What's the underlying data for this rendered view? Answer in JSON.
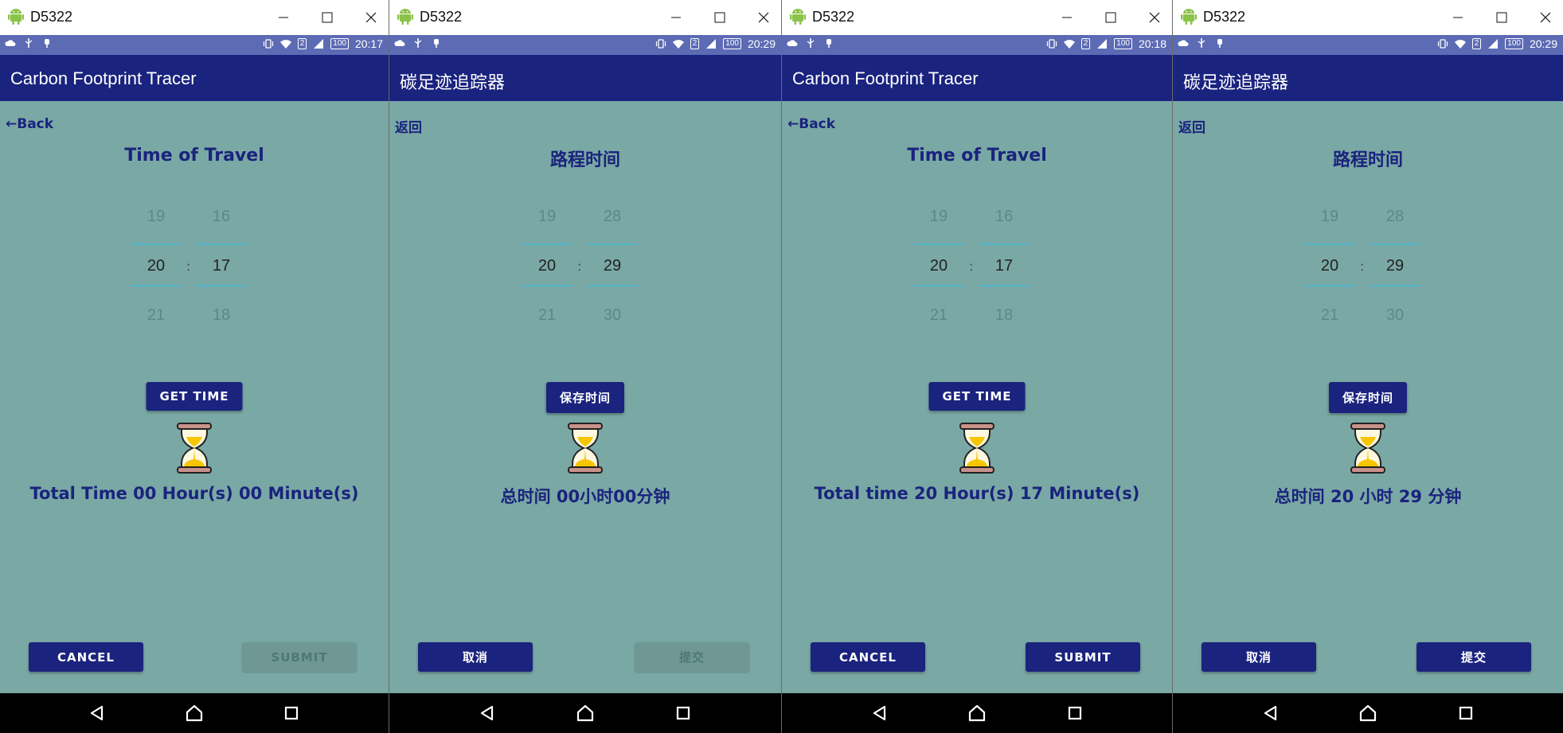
{
  "windows": [
    {
      "title": "D5322",
      "status_time": "20:17",
      "battery": "100",
      "sim": "2",
      "app_title": "Carbon Footprint Tracer",
      "back": "←Back",
      "heading": "Time of Travel",
      "picker": {
        "hour_prev": "19",
        "hour": "20",
        "hour_next": "21",
        "min_prev": "16",
        "min": "17",
        "min_next": "18",
        "sep": ":"
      },
      "get_time": "GET TIME",
      "total": "Total Time 00 Hour(s) 00 Minute(s)",
      "cancel": "CANCEL",
      "submit": "SUBMIT",
      "submit_enabled": false
    },
    {
      "title": "D5322",
      "status_time": "20:29",
      "battery": "100",
      "sim": "2",
      "app_title": "碳足迹追踪器",
      "back": "返回",
      "heading": "路程时间",
      "picker": {
        "hour_prev": "19",
        "hour": "20",
        "hour_next": "21",
        "min_prev": "28",
        "min": "29",
        "min_next": "30",
        "sep": ":"
      },
      "get_time": "保存时间",
      "total": "总时间 00小时00分钟",
      "cancel": "取消",
      "submit": "提交",
      "submit_enabled": false
    },
    {
      "title": "D5322",
      "status_time": "20:18",
      "battery": "100",
      "sim": "2",
      "app_title": "Carbon Footprint Tracer",
      "back": "←Back",
      "heading": "Time of Travel",
      "picker": {
        "hour_prev": "19",
        "hour": "20",
        "hour_next": "21",
        "min_prev": "16",
        "min": "17",
        "min_next": "18",
        "sep": ":"
      },
      "get_time": "GET TIME",
      "total": "Total time 20 Hour(s) 17 Minute(s)",
      "cancel": "CANCEL",
      "submit": "SUBMIT",
      "submit_enabled": true
    },
    {
      "title": "D5322",
      "status_time": "20:29",
      "battery": "100",
      "sim": "2",
      "app_title": "碳足迹追踪器",
      "back": "返回",
      "heading": "路程时间",
      "picker": {
        "hour_prev": "19",
        "hour": "20",
        "hour_next": "21",
        "min_prev": "28",
        "min": "29",
        "min_next": "30",
        "sep": ":"
      },
      "get_time": "保存时间",
      "total": "总时间 20 小时 29 分钟",
      "cancel": "取消",
      "submit": "提交",
      "submit_enabled": true
    }
  ],
  "icons": {
    "app": "android-icon",
    "minimize": "minimize-icon",
    "maximize": "maximize-icon",
    "close": "close-icon",
    "wifi": "wifi-icon",
    "signal": "signal-icon",
    "vibrate": "vibrate-icon",
    "hourglass": "hourglass-icon",
    "nav_back": "nav-back-icon",
    "nav_home": "nav-home-icon",
    "nav_recents": "nav-recents-icon"
  },
  "colors": {
    "app_bar": "#1a237e",
    "status_bar": "#5c6bb4",
    "background": "#7aa8a4",
    "accent_line": "#4fb3c8",
    "disabled_button": "#6f9895"
  }
}
